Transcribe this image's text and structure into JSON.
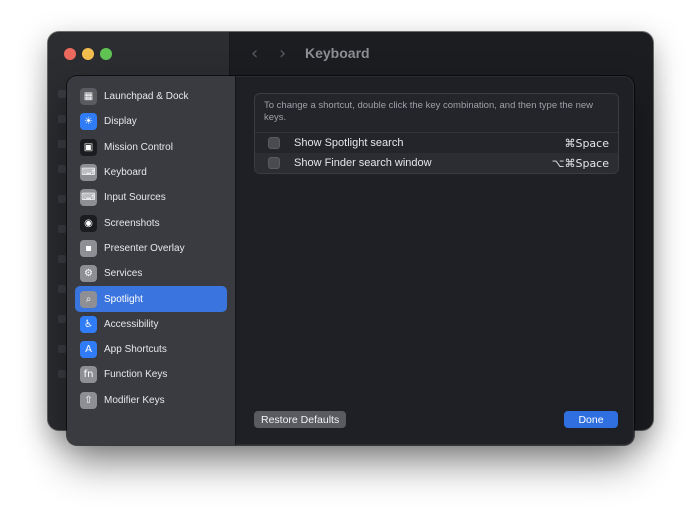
{
  "parent_window": {
    "title": "Keyboard",
    "back_glyph": "‹",
    "forward_glyph": "›"
  },
  "sheet": {
    "sidebar": {
      "items": [
        {
          "label": "Launchpad & Dock",
          "icon": "launchpad-dock-icon",
          "glyph": "▦",
          "color": "#5a5b61"
        },
        {
          "label": "Display",
          "icon": "display-icon",
          "glyph": "☀",
          "color": "#2f7cf6"
        },
        {
          "label": "Mission Control",
          "icon": "mission-control-icon",
          "glyph": "▣",
          "color": "#1b1c1f"
        },
        {
          "label": "Keyboard",
          "icon": "keyboard-icon",
          "glyph": "⌨",
          "color": "#8e8f94"
        },
        {
          "label": "Input Sources",
          "icon": "input-sources-icon",
          "glyph": "⌨",
          "color": "#8e8f94"
        },
        {
          "label": "Screenshots",
          "icon": "screenshots-icon",
          "glyph": "◉",
          "color": "#1b1c1f"
        },
        {
          "label": "Presenter Overlay",
          "icon": "presenter-overlay-icon",
          "glyph": "▪",
          "color": "#8e8f94"
        },
        {
          "label": "Services",
          "icon": "services-icon",
          "glyph": "⚙",
          "color": "#8e8f94"
        },
        {
          "label": "Spotlight",
          "icon": "spotlight-icon",
          "glyph": "⌕",
          "color": "#8e8f94",
          "active": true
        },
        {
          "label": "Accessibility",
          "icon": "accessibility-icon",
          "glyph": "♿",
          "color": "#2f7cf6"
        },
        {
          "label": "App Shortcuts",
          "icon": "app-shortcuts-icon",
          "glyph": "A",
          "color": "#2f7cf6"
        },
        {
          "label": "Function Keys",
          "icon": "function-keys-icon",
          "glyph": "fn",
          "color": "#8e8f94"
        },
        {
          "label": "Modifier Keys",
          "icon": "modifier-keys-icon",
          "glyph": "⇧",
          "color": "#8e8f94"
        }
      ]
    },
    "hint": "To change a shortcut, double click the key combination, and then type the new keys.",
    "shortcuts": [
      {
        "label": "Show Spotlight search",
        "keys": "⌘Space",
        "checked": false
      },
      {
        "label": "Show Finder search window",
        "keys": "⌥⌘Space",
        "checked": false
      }
    ],
    "restore_label": "Restore Defaults",
    "done_label": "Done"
  },
  "colors": {
    "accent": "#3a74de",
    "done_button": "#2f6fe0",
    "traffic_red": "#ed6a5e",
    "traffic_yellow": "#f5bf4f",
    "traffic_green": "#61c554"
  }
}
